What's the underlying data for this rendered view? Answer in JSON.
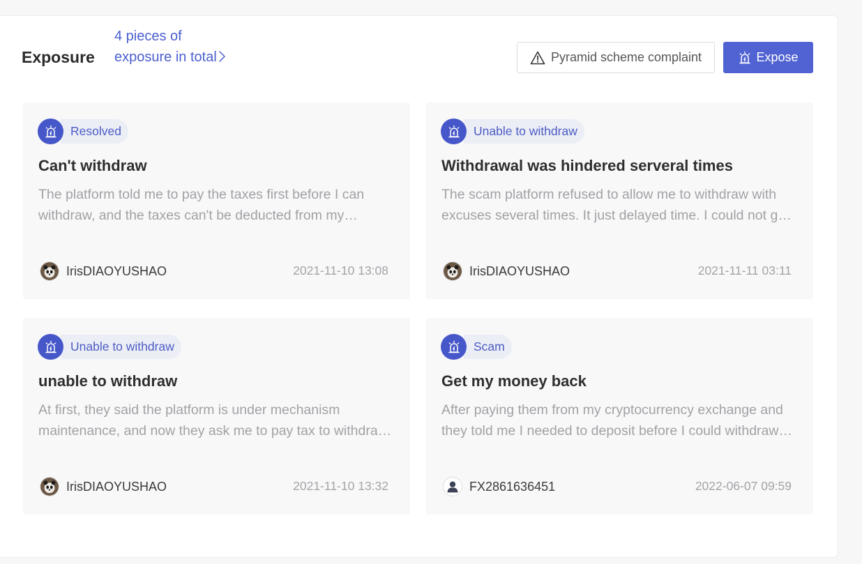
{
  "header": {
    "title": "Exposure",
    "count_link": "4 pieces of exposure in total",
    "complaint_button": "Pyramid scheme complaint",
    "expose_button": "Expose"
  },
  "colors": {
    "accent": "#5163d2",
    "tag_icon": "#4657c9",
    "tag_text": "#4c5cc4",
    "muted_text": "#a2a2a6"
  },
  "icons": {
    "count_link": "chevron-right-icon",
    "complaint_button": "warning-triangle-icon",
    "expose_button": "alarm-siren-icon",
    "tag": "alarm-siren-icon"
  },
  "cards": [
    {
      "tag": "Resolved",
      "title": "Can't withdraw",
      "description": "The platform told me to pay the taxes first before I can withdraw, and the taxes can't be deducted from my account balance.",
      "author": "IrisDIAOYUSHAO",
      "avatar": "panda-avatar",
      "time": "2021-11-10 13:08"
    },
    {
      "tag": "Unable to withdraw",
      "title": "Withdrawal was hindered serveral times",
      "description": "The scam platform refused to allow me to withdraw with excuses several times. It just delayed time. I could not get my money.",
      "author": "IrisDIAOYUSHAO",
      "avatar": "panda-avatar",
      "time": "2021-11-11 03:11"
    },
    {
      "tag": "Unable to withdraw",
      "title": "unable to withdraw",
      "description": "At first, they said the platform is under mechanism maintenance, and now they ask me to pay tax to withdraw my funds.",
      "author": "IrisDIAOYUSHAO",
      "avatar": "panda-avatar",
      "time": "2021-11-10 13:32"
    },
    {
      "tag": "Scam",
      "title": "Get my money back",
      "description": "After paying them from my cryptocurrency exchange and they told me I needed to deposit before I could withdraw my money.",
      "author": "FX2861636451",
      "avatar": "default-user-avatar",
      "time": "2022-06-07 09:59"
    }
  ]
}
